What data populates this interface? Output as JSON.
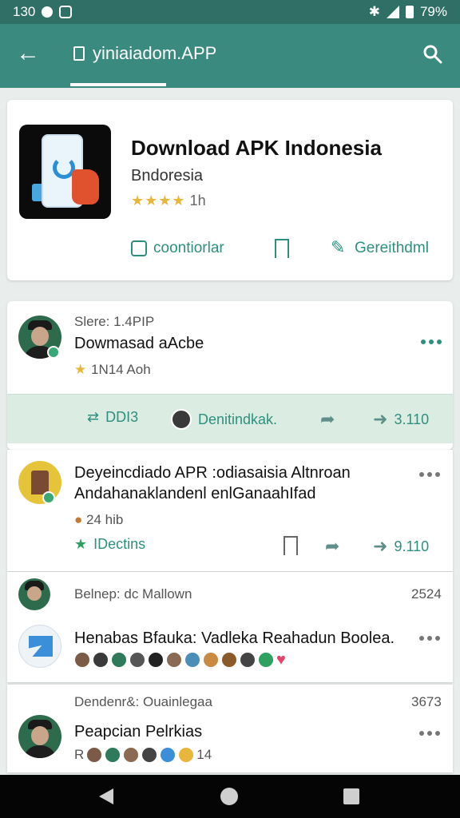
{
  "status_bar": {
    "time": "130",
    "battery": "79%"
  },
  "app_bar": {
    "title": "yiniaiadom.APP"
  },
  "app_card": {
    "title": "Download APK Indonesia",
    "subtitle": "Bndoresia",
    "rating_stars": "★★★★",
    "rating_count": "1h",
    "actions": [
      "coontiorlar",
      "",
      "Gereithdml"
    ]
  },
  "post1": {
    "meta": "Slere: 1.4PIP",
    "title": "Dowmasad aAcbe",
    "rating": "1N14 Aoh",
    "bar": {
      "share": "DDI3",
      "user": "Denitindkak.",
      "count": "3.110"
    }
  },
  "post2": {
    "title_line1": "Deyeincdiado APR :odiasaisia Altnroan",
    "title_line2": "Andahanaklandenl enlGanaahIfad",
    "count": "24 hib",
    "tag": "IDectins",
    "share_count": "9.110"
  },
  "post3": {
    "meta": "Belnep: dc Mallown",
    "count": "2524",
    "title": "Henabas Bfauka: Vadleka Reahadun Boolea."
  },
  "post4": {
    "meta": "Dendenr&: Ouainlegaa",
    "count": "3673",
    "title": "Peapcian Pelrkias",
    "reacts_prefix": "R",
    "reacts_count": "14"
  },
  "colors": {
    "accent": "#2f8f7f",
    "appbar": "#3a8a80",
    "statusbar": "#2f6f66"
  }
}
